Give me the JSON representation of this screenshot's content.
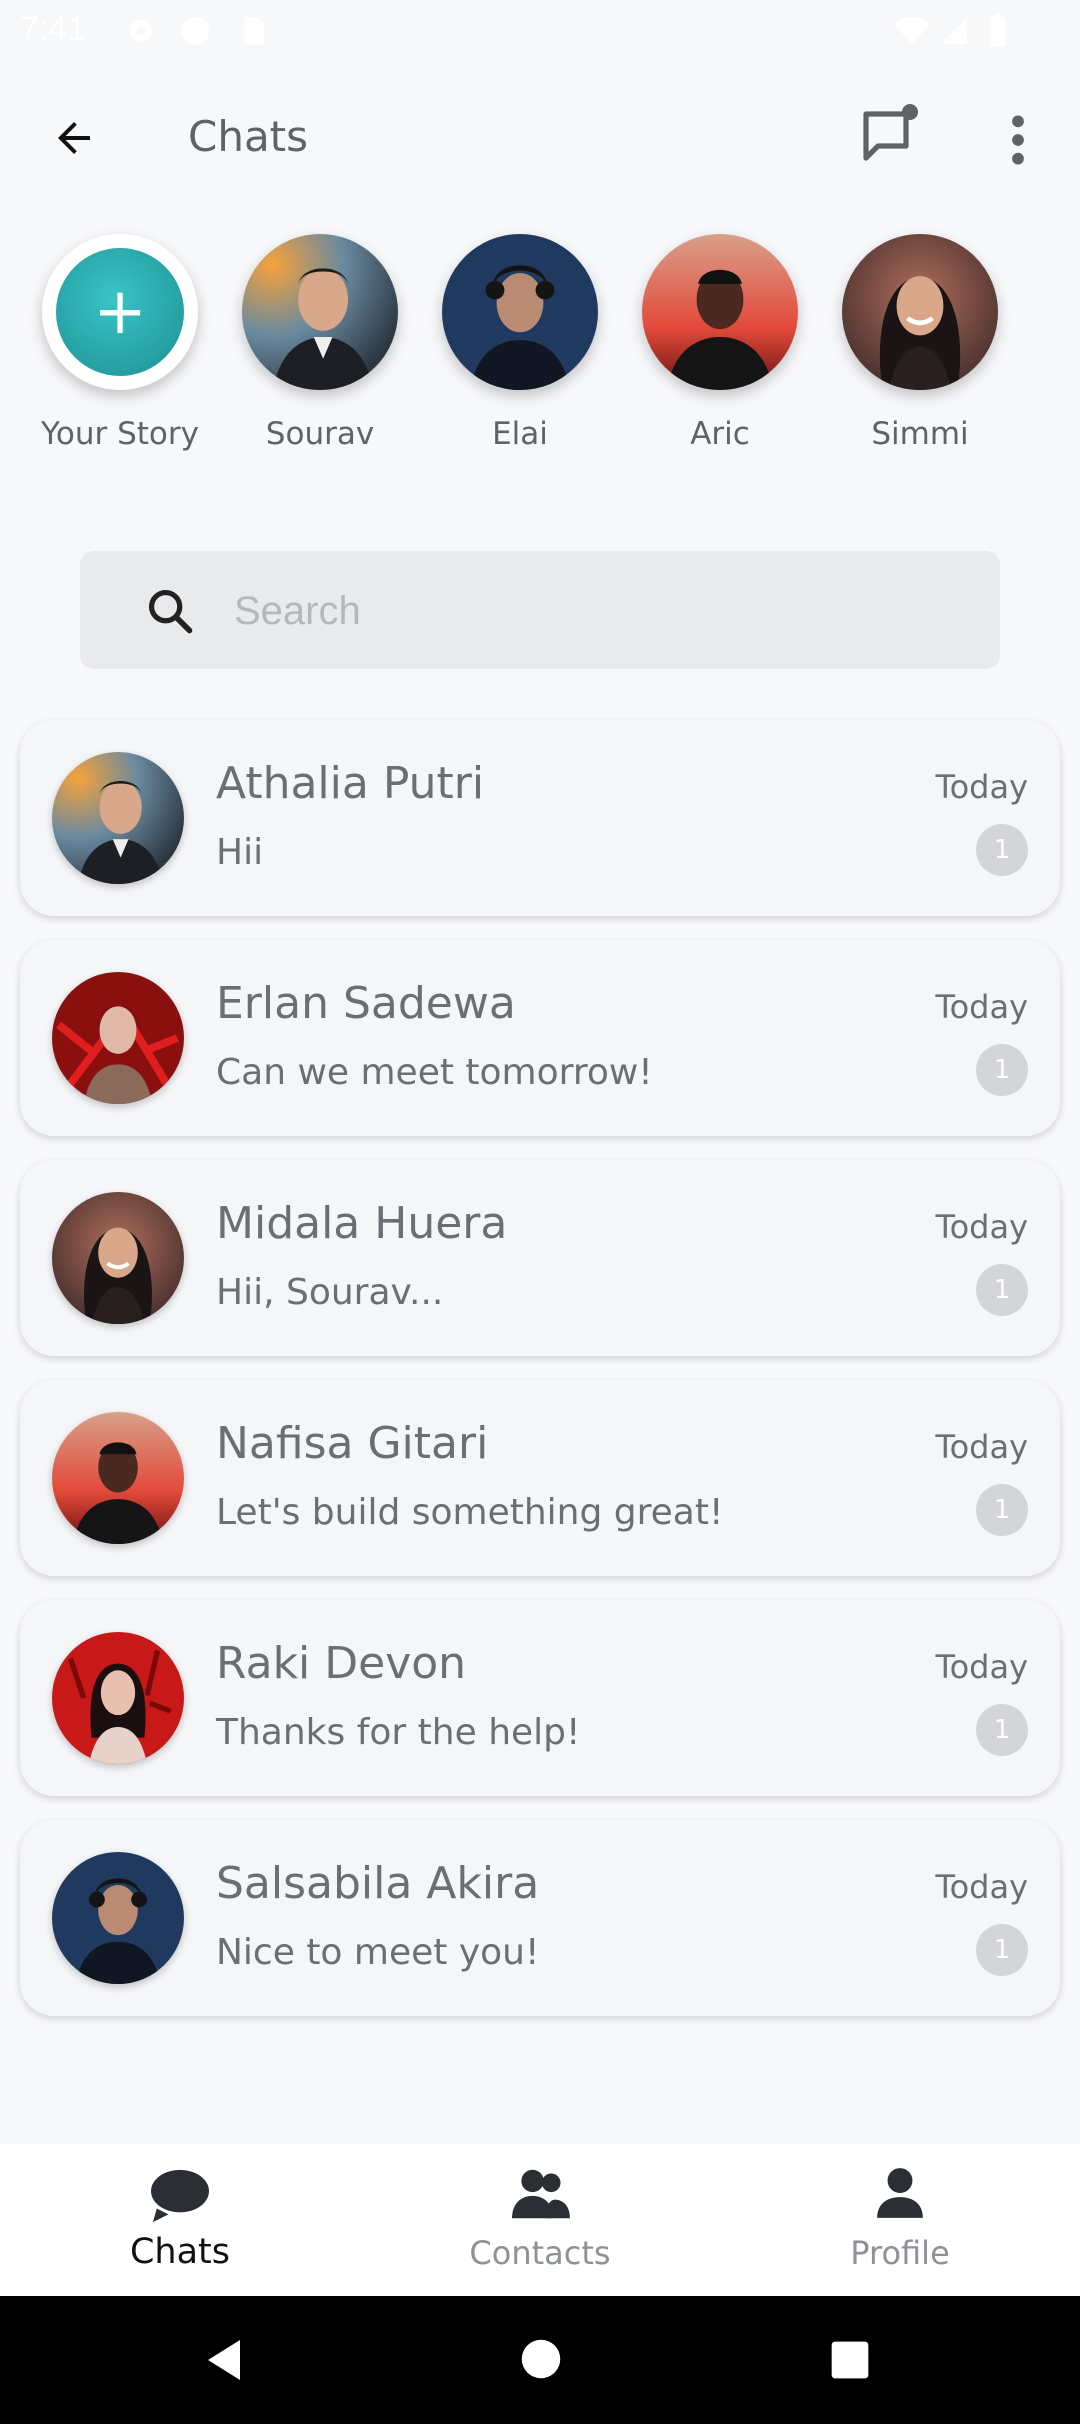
{
  "status_bar": {
    "time": "7:41"
  },
  "app_bar": {
    "title": "Chats"
  },
  "stories": [
    {
      "name": "Your Story",
      "type": "add"
    },
    {
      "name": "Sourav",
      "avatar": "avatar-man-suit"
    },
    {
      "name": "Elai",
      "avatar": "avatar-man-curly"
    },
    {
      "name": "Aric",
      "avatar": "avatar-man-red"
    },
    {
      "name": "Simmi",
      "avatar": "avatar-woman-smile"
    }
  ],
  "search": {
    "placeholder": "Search"
  },
  "chats": [
    {
      "name": "Athalia Putri",
      "message": "Hii",
      "time": "Today",
      "unread": "1",
      "avatar": "avatar-man-suit"
    },
    {
      "name": "Erlan Sadewa",
      "message": "Can we meet tomorrow!",
      "time": "Today",
      "unread": "1",
      "avatar": "avatar-woman-red"
    },
    {
      "name": "Midala Huera",
      "message": "Hii, Sourav...",
      "time": "Today",
      "unread": "1",
      "avatar": "avatar-woman-smile"
    },
    {
      "name": "Nafisa Gitari",
      "message": "Let's build something great!",
      "time": "Today",
      "unread": "1",
      "avatar": "avatar-man-red"
    },
    {
      "name": "Raki Devon",
      "message": "Thanks for the help!",
      "time": "Today",
      "unread": "1",
      "avatar": "avatar-woman-redbg"
    },
    {
      "name": "Salsabila Akira",
      "message": "Nice to meet you!",
      "time": "Today",
      "unread": "1",
      "avatar": "avatar-man-curly"
    }
  ],
  "bottom_nav": [
    {
      "label": "Chats",
      "icon": "chat-bubble-icon",
      "active": true
    },
    {
      "label": "Contacts",
      "icon": "contacts-icon",
      "active": false
    },
    {
      "label": "Profile",
      "icon": "person-icon",
      "active": false
    }
  ],
  "colors": {
    "accent": "#1d8f93",
    "text_muted": "#6b6f75",
    "badge": "#d3d5d8"
  }
}
